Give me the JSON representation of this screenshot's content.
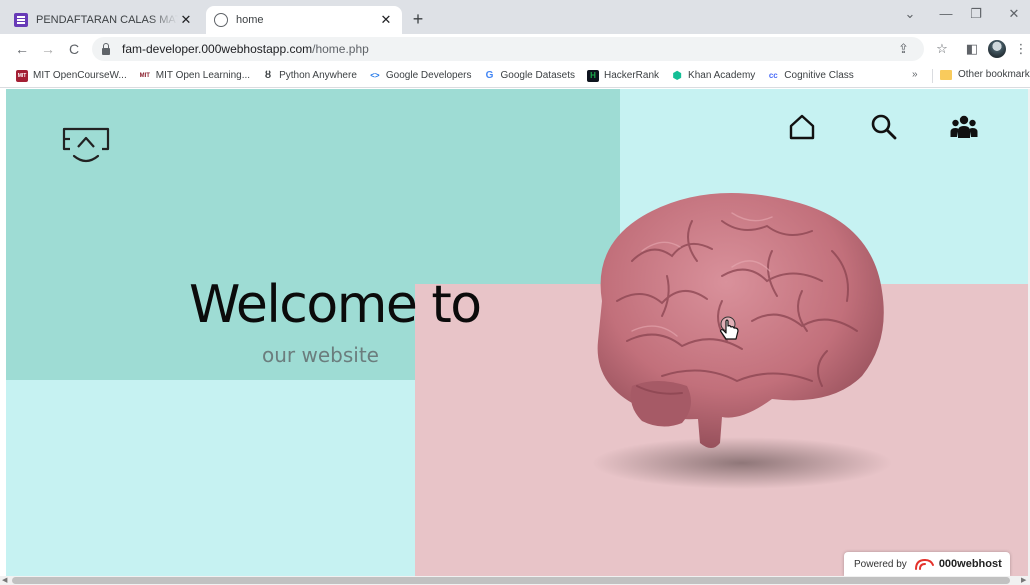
{
  "browser": {
    "tabs": [
      {
        "title": "PENDAFTARAN CALAS MATHDAY",
        "active": false,
        "favicon": "google-forms-icon"
      },
      {
        "title": "home",
        "active": true,
        "favicon": "globe-icon"
      }
    ],
    "tab_close_glyph": "✕",
    "new_tab_glyph": "+",
    "window_controls": {
      "tab_search": "⌄",
      "minimize": "—",
      "restore": "❐",
      "close": "✕"
    },
    "nav": {
      "back": "←",
      "forward": "→",
      "reload": "C"
    },
    "address": {
      "host": "fam-developer.000webhostapp.com",
      "path": "/home.php"
    },
    "toolbar_icons": {
      "share": "⇪",
      "bookmark_star": "☆",
      "side_panel": "◧",
      "menu": "⋮"
    },
    "bookmarks": [
      {
        "label": "MIT OpenCourseW...",
        "icon": "mit-ocw-icon",
        "badge": "MIT",
        "color": "#a31f34"
      },
      {
        "label": "MIT Open Learning...",
        "icon": "mit-logo-icon",
        "badge": "MIT",
        "color": "#8a1e2c"
      },
      {
        "label": "Python Anywhere",
        "icon": "python-anywhere-icon",
        "badge": "ȣ",
        "color": "#3c4043"
      },
      {
        "label": "Google Developers",
        "icon": "google-developers-icon",
        "badge": "<>",
        "color": "#1a73e8"
      },
      {
        "label": "Google Datasets",
        "icon": "google-icon",
        "badge": "G",
        "color": "#4285f4"
      },
      {
        "label": "HackerRank",
        "icon": "hackerrank-icon",
        "badge": "H",
        "color": "#1ba94c"
      },
      {
        "label": "Khan Academy",
        "icon": "khan-academy-icon",
        "badge": "⬢",
        "color": "#14bf96"
      },
      {
        "label": "Cognitive Class",
        "icon": "cognitive-class-icon",
        "badge": "cc",
        "color": "#4a6cf7"
      }
    ],
    "bookmarks_overflow": "»",
    "other_bookmarks": "Other bookmarks"
  },
  "page": {
    "colors": {
      "teal": "#9edcd4",
      "light_cyan": "#c6f2f2",
      "pink": "#e8c4c8",
      "brain": "#c2707b"
    },
    "nav_icons": [
      "home-icon",
      "search-icon",
      "users-icon"
    ],
    "hero": {
      "title": "Welcome to",
      "subtitle": "our website"
    },
    "powered_by": {
      "prefix": "Powered by",
      "brand": "000webhost"
    }
  }
}
